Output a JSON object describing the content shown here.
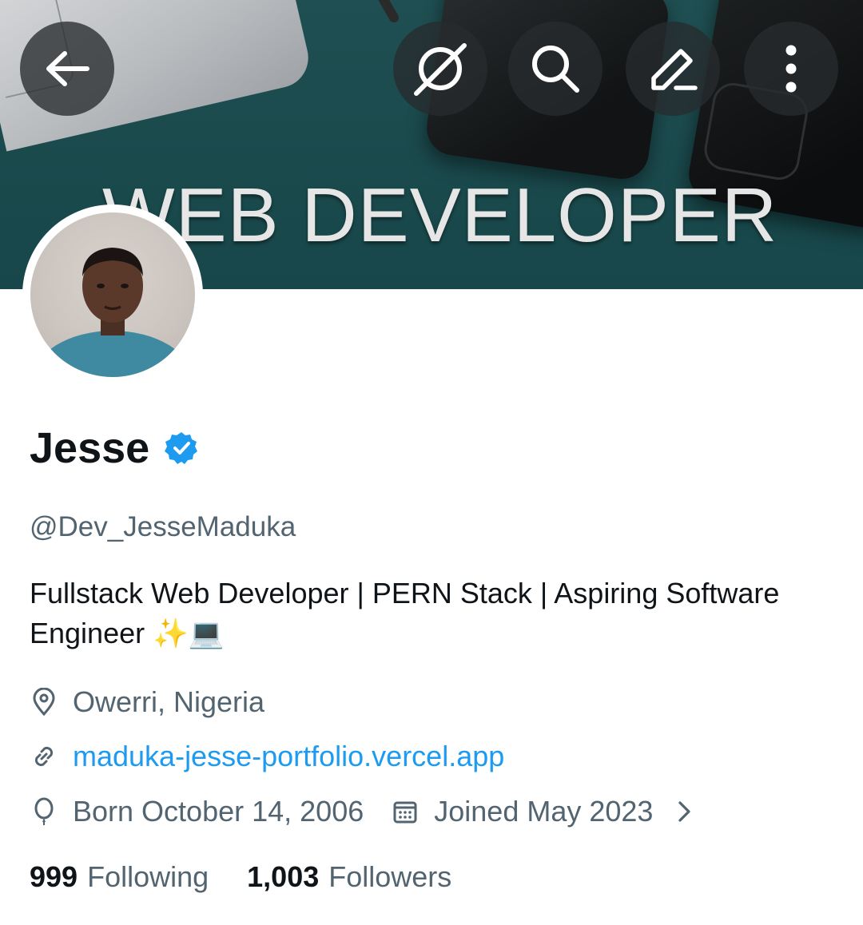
{
  "banner": {
    "headline": "WEB DEVELOPER"
  },
  "top_bar": {
    "back_icon": "arrow-left-icon",
    "grok_icon": "grok-icon",
    "search_icon": "search-icon",
    "edit_icon": "pencil-icon",
    "more_icon": "more-vertical-icon"
  },
  "profile": {
    "name": "Jesse",
    "verified_color": "#1d9bf0",
    "handle": "@Dev_JesseMaduka",
    "bio": "Fullstack Web Developer | PERN Stack | Aspiring Software Engineer ✨💻",
    "location": "Owerri, Nigeria",
    "website": "maduka-jesse-portfolio.vercel.app",
    "born": "Born October 14, 2006",
    "joined": "Joined May 2023"
  },
  "stats": {
    "following_count": "999",
    "following_label": "Following",
    "followers_count": "1,003",
    "followers_label": "Followers"
  },
  "colors": {
    "banner": "#1b4a4d",
    "link": "#1d9bf0",
    "secondary_text": "#536471",
    "primary_text": "#0f1419"
  }
}
